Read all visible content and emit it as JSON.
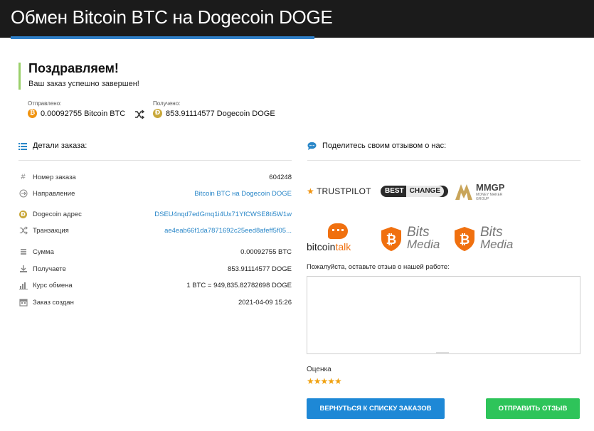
{
  "header": {
    "title": "Обмен Bitcoin BTC на Dogecoin DOGE"
  },
  "success": {
    "heading": "Поздравляем!",
    "message": "Ваш заказ успешно завершен!"
  },
  "exchange": {
    "sent_label": "Отправлено:",
    "sent_value": "0.00092755 Bitcoin BTC",
    "received_label": "Получено:",
    "received_value": "853.91114577 Dogecoin DOGE"
  },
  "details": {
    "title": "Детали заказа:",
    "rows": [
      {
        "label": "Номер заказа",
        "value": "604248"
      },
      {
        "label": "Направление",
        "value": "Bitcoin BTC на Dogecoin DOGE"
      },
      {
        "label": "Dogecoin адрес",
        "value": "DSEU4nqd7edGmq1i4Ux71YfCWSE8ti5W1w"
      },
      {
        "label": "Транзакция",
        "value": "ae4eab66f1da7871692c25eed8afeff5f05..."
      },
      {
        "label": "Сумма",
        "value": "0.00092755 BTC"
      },
      {
        "label": "Получаете",
        "value": "853.91114577 DOGE"
      },
      {
        "label": "Курс обмена",
        "value": "1 BTC = 949,835.82782698 DOGE"
      },
      {
        "label": "Заказ создан",
        "value": "2021-04-09 15:26"
      }
    ]
  },
  "feedback": {
    "title": "Поделитесь своим отзывом о нас:",
    "logos": {
      "trustpilot": "TRUSTPILOT",
      "bestchange_best": "BEST",
      "bestchange_change": "CHANGE",
      "mmgp": "MMGP",
      "mmgp_sub": "MONEY MAKER GROUP",
      "bitcointalk_a": "bitcoin",
      "bitcointalk_b": "talk",
      "bits": "Bits",
      "media": "Media"
    },
    "prompt": "Пожалуйста, оставьте отзыв о нашей работе:",
    "text_value": "",
    "rating_label": "Оценка",
    "rating": 5,
    "rating_max": 5,
    "stars": "★★★★★"
  },
  "buttons": {
    "back": "ВЕРНУТЬСЯ К СПИСКУ ЗАКАЗОВ",
    "send": "ОТПРАВИТЬ ОТЗЫВ"
  },
  "colors": {
    "topbar": "#1b1b1b",
    "accent": "#2f7fc8",
    "link": "#2a87c8",
    "success_bar": "#9ad06b",
    "back_button": "#1e88d6",
    "send_button": "#2ec45a",
    "star": "#f0a10f",
    "bitcoin": "#f0930f"
  }
}
